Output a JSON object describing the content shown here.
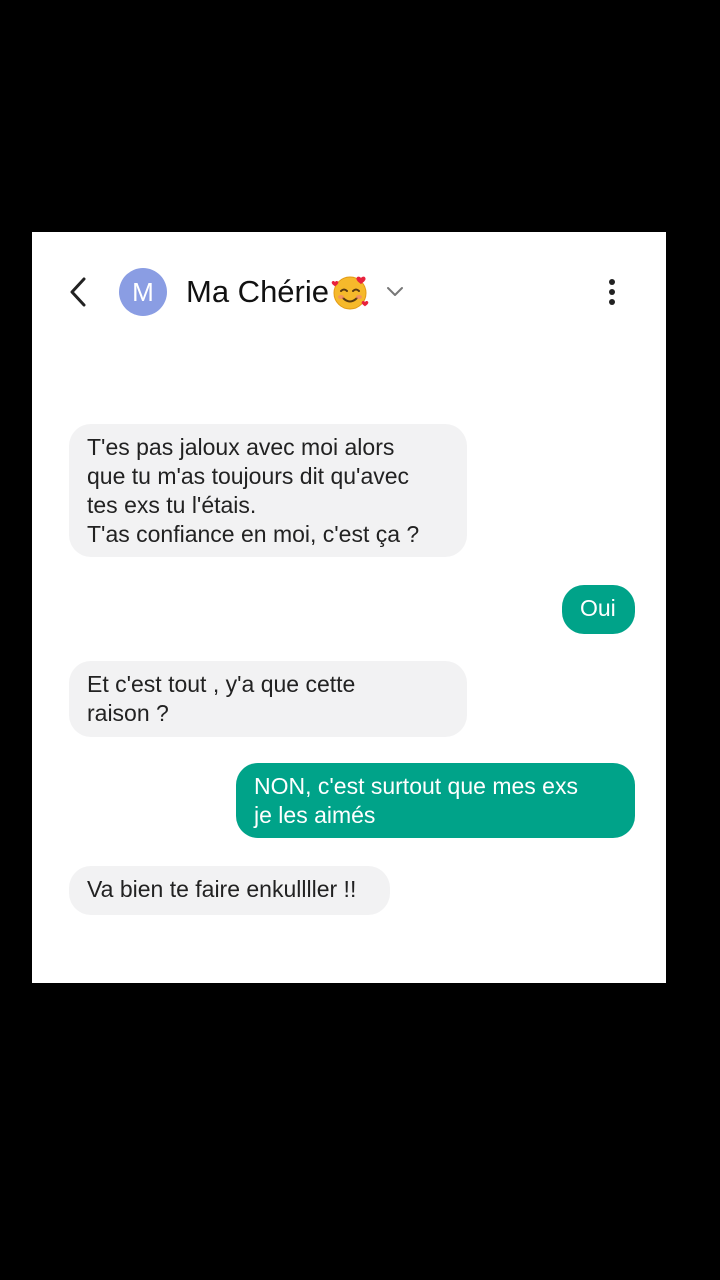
{
  "header": {
    "avatar_letter": "M",
    "contact_name": "Ma Chérie",
    "contact_emoji": "smiling-face-with-hearts-icon",
    "back_icon": "chevron-left-icon",
    "dropdown_icon": "chevron-down-icon",
    "menu_icon": "more-vertical-icon"
  },
  "colors": {
    "outgoing_bubble": "#00a389",
    "incoming_bubble": "#f2f2f3",
    "avatar": "#8a9de3"
  },
  "messages": [
    {
      "direction": "incoming",
      "text": "T'es pas jaloux avec moi alors\nque tu m'as toujours dit qu'avec\ntes exs tu l'étais.\nT'as confiance en moi,  c'est ça ?"
    },
    {
      "direction": "outgoing",
      "text": "Oui"
    },
    {
      "direction": "incoming",
      "text": "Et c'est tout , y'a que cette\nraison ?"
    },
    {
      "direction": "outgoing",
      "text": "NON, c'est surtout que mes exs\nje les aimés"
    },
    {
      "direction": "incoming",
      "text": "Va bien te faire enkullller !!"
    }
  ]
}
